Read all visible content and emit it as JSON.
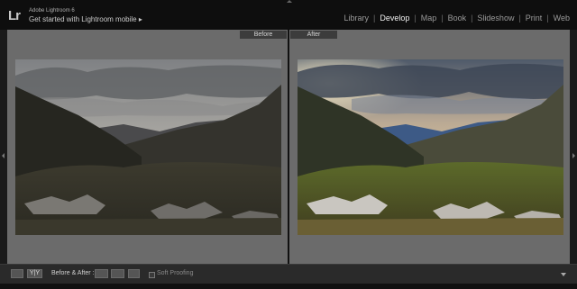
{
  "app": {
    "logo": "Lr",
    "name": "Adobe Lightroom 6",
    "mobile_link": "Get started with Lightroom mobile ▸"
  },
  "modules": [
    {
      "label": "Library",
      "active": false
    },
    {
      "label": "Develop",
      "active": true
    },
    {
      "label": "Map",
      "active": false
    },
    {
      "label": "Book",
      "active": false
    },
    {
      "label": "Slideshow",
      "active": false
    },
    {
      "label": "Print",
      "active": false
    },
    {
      "label": "Web",
      "active": false
    }
  ],
  "compare": {
    "before_label": "Before",
    "after_label": "After"
  },
  "toolbar": {
    "view_mode_label": "Y|Y",
    "before_after_label": "Before & After :",
    "soft_proofing_label": "Soft Proofing",
    "soft_proofing_checked": false
  },
  "icons": {
    "loupe": "loupe-view-icon",
    "copy_before_to_after": "copy-before-to-after-icon",
    "copy_after_to_before": "copy-after-to-before-icon",
    "swap": "swap-icon",
    "menu": "chevron-down-icon"
  },
  "colors": {
    "active_module": "#f0f0f0",
    "inactive_module": "#9a9a9a",
    "pane_bg": "#6b6b6b"
  }
}
